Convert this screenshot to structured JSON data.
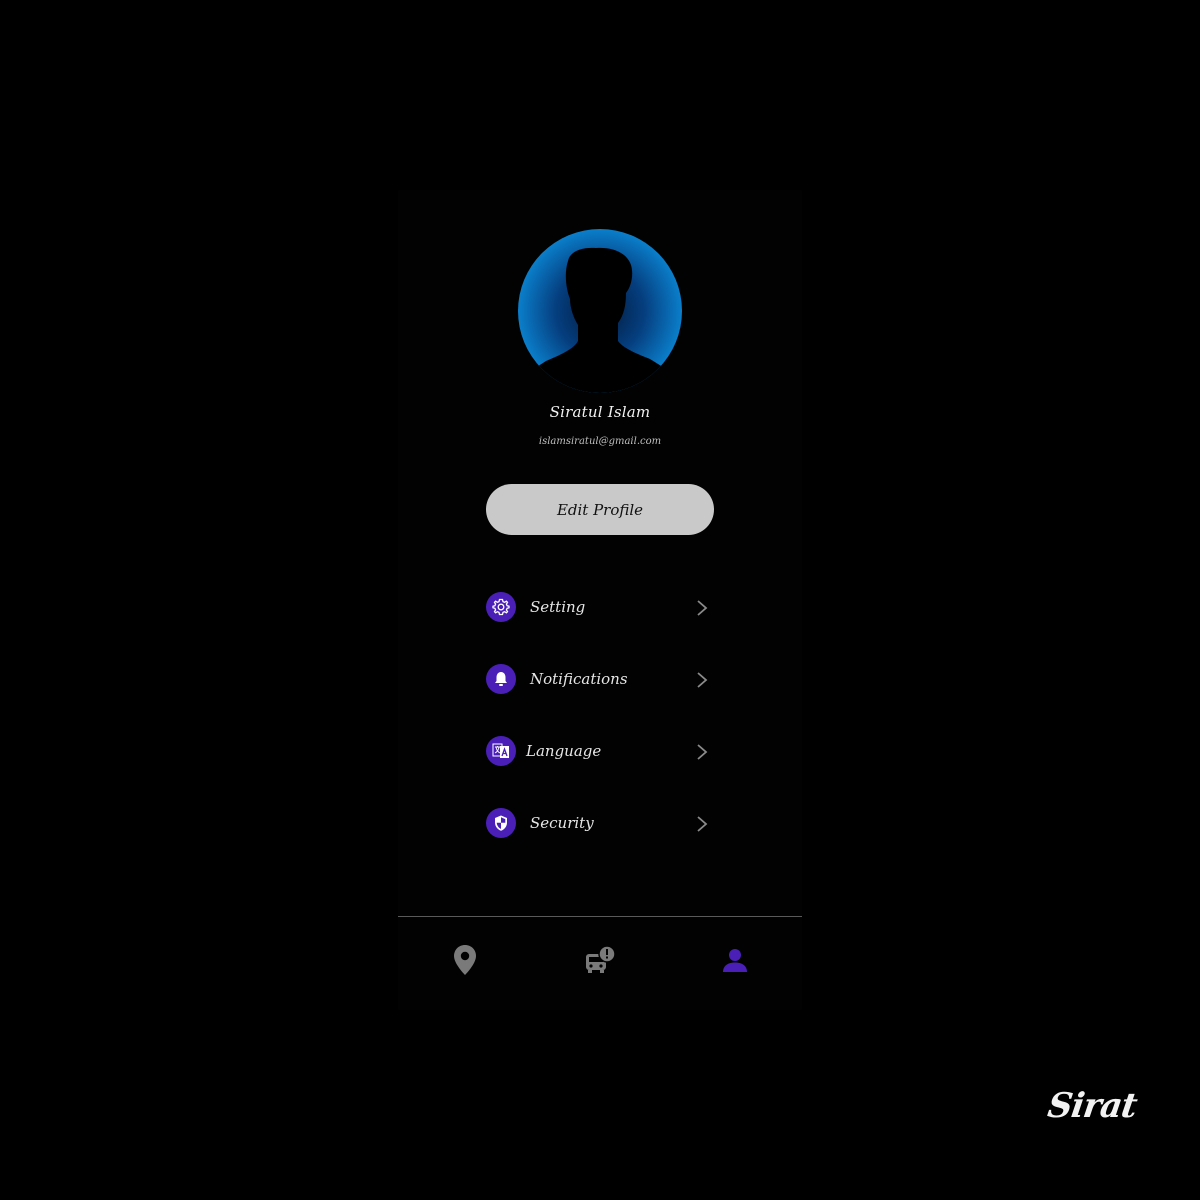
{
  "profile": {
    "name": "Siratul Islam",
    "email": "islamsiratul@gmail.com",
    "avatar_icon": "person-silhouette-icon",
    "edit_label": "Edit Profile"
  },
  "menu": [
    {
      "label": "Setting",
      "icon": "gear-icon"
    },
    {
      "label": "Notifications",
      "icon": "bell-icon"
    },
    {
      "label": "Language",
      "icon": "translate-icon"
    },
    {
      "label": "Security",
      "icon": "shield-icon"
    }
  ],
  "bottom_nav": [
    {
      "icon": "location-pin-icon",
      "active": false
    },
    {
      "icon": "bus-alert-icon",
      "active": false
    },
    {
      "icon": "person-icon",
      "active": true
    }
  ],
  "colors": {
    "background": "#000000",
    "accent": "#4a1fb8",
    "nav_inactive": "#7a7a7a",
    "button": "#c9c9c9"
  },
  "watermark": "Sirat"
}
